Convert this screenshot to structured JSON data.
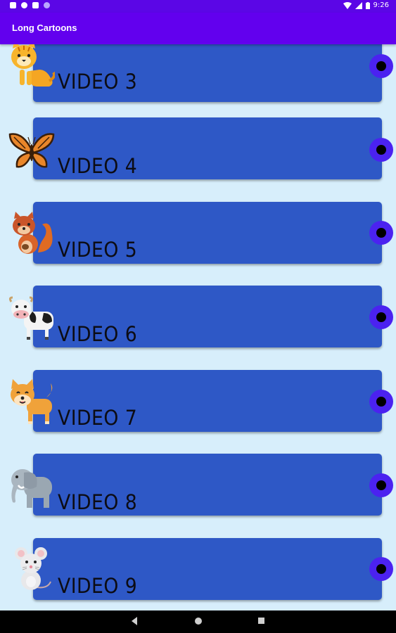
{
  "status_bar": {
    "time": "9:26"
  },
  "app_bar": {
    "title": "Long Cartoons"
  },
  "items": [
    {
      "label": "VIDEO 3",
      "icon": "tiger-icon"
    },
    {
      "label": "VIDEO 4",
      "icon": "butterfly-icon"
    },
    {
      "label": "VIDEO 5",
      "icon": "squirrel-icon"
    },
    {
      "label": "VIDEO 6",
      "icon": "cow-icon"
    },
    {
      "label": "VIDEO 7",
      "icon": "dog-icon"
    },
    {
      "label": "VIDEO 8",
      "icon": "elephant-icon"
    },
    {
      "label": "VIDEO 9",
      "icon": "mouse-icon"
    }
  ],
  "colors": {
    "app_bar": "#6200ee",
    "status_bar": "#5b06e6",
    "card": "#2e58c6",
    "background": "#d7eefb",
    "radio": "#4b22f0"
  }
}
